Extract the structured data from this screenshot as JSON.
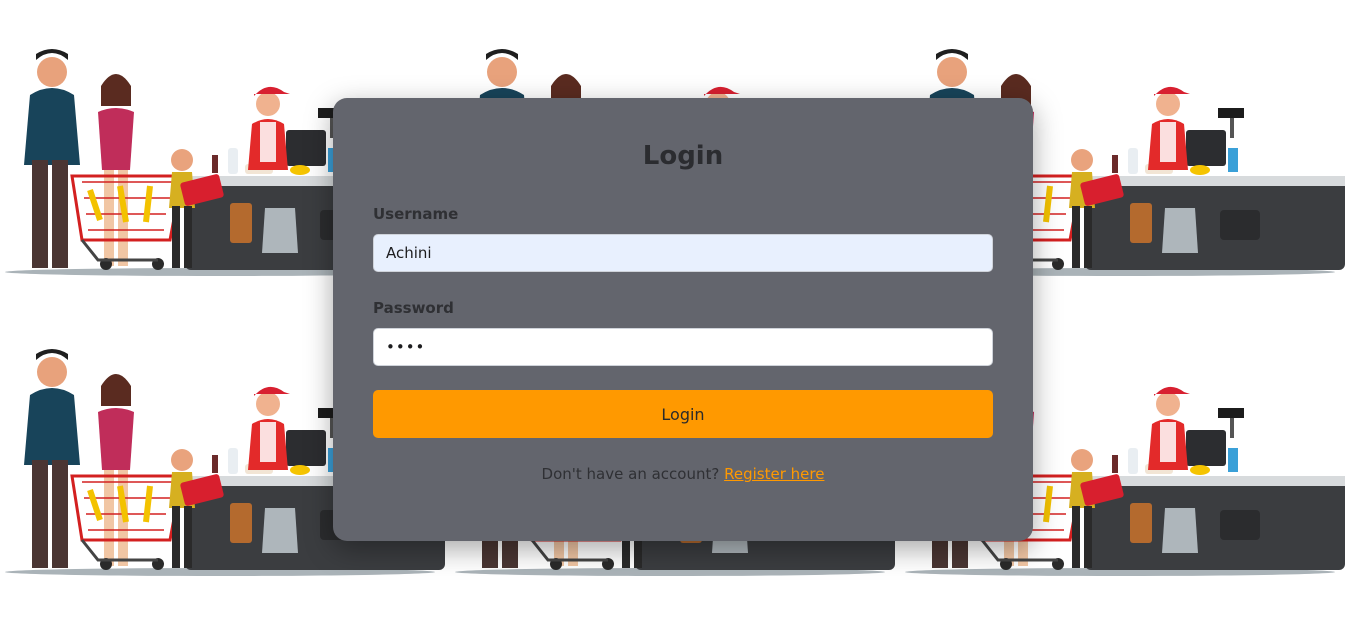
{
  "login": {
    "title": "Login",
    "username_label": "Username",
    "username_value": "Achini",
    "password_label": "Password",
    "password_value": "1234",
    "submit_label": "Login",
    "footer_text": "Don't have an account?",
    "register_link": "Register here"
  },
  "colors": {
    "card_background": "#63656d",
    "accent": "#ff9900",
    "username_field": "#e8f0fe"
  },
  "background": {
    "illustration": "supermarket-checkout-illustration"
  }
}
